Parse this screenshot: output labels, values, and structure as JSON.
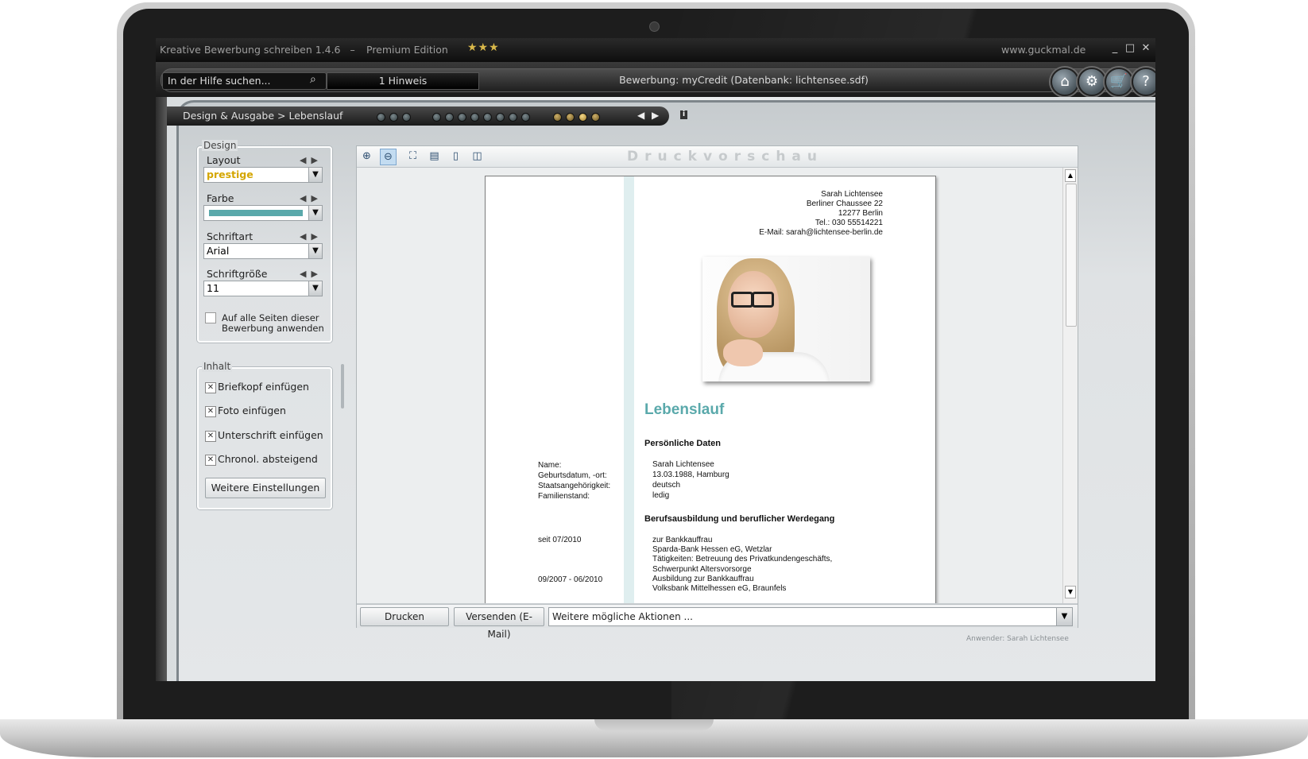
{
  "window": {
    "title": "Kreative Bewerbung schreiben 1.4.6",
    "separator": "–",
    "edition": "Premium Edition",
    "stars": "★★★",
    "website": "www.guckmal.de",
    "minimize": "_",
    "maximize": "□",
    "close": "✕"
  },
  "toolbar": {
    "search_placeholder": "In der Hilfe suchen...",
    "hint": "1 Hinweis",
    "status": "Bewerbung: myCredit (Datenbank: lichtensee.sdf)",
    "buttons": {
      "home_icon": "⌂",
      "settings_icon": "⚙",
      "cart_icon": "🛒",
      "help_icon": "?"
    }
  },
  "breadcrumb": {
    "text": "Design & Ausgabe > Lebenslauf",
    "prev": "◀",
    "next": "▶",
    "info": "i"
  },
  "design": {
    "legend": "Design",
    "layout_label": "Layout",
    "layout_value": "prestige",
    "farbe_label": "Farbe",
    "color_value": "#5aa9ab",
    "schriftart_label": "Schriftart",
    "schriftart_value": "Arial",
    "schriftgroesse_label": "Schriftgröße",
    "schriftgroesse_value": "11",
    "apply_all_line1": "Auf alle Seiten dieser",
    "apply_all_line2": "Bewerbung anwenden",
    "apply_all_checked": false,
    "arrows": "◀▶",
    "dropdown_arrow": "▼"
  },
  "inhalt": {
    "legend": "Inhalt",
    "items": [
      {
        "label": "Briefkopf einfügen",
        "checked": true,
        "mark": "✕"
      },
      {
        "label": "Foto einfügen",
        "checked": true,
        "mark": "✕"
      },
      {
        "label": "Unterschrift einfügen",
        "checked": true,
        "mark": "✕"
      },
      {
        "label": "Chronol. absteigend",
        "checked": true,
        "mark": "✕"
      }
    ],
    "more_settings": "Weitere Einstellungen"
  },
  "preview": {
    "title": "Druckvorschau",
    "document": {
      "sender_name": "Sarah Lichtensee",
      "sender_street": "Berliner Chaussee 22",
      "sender_city": "12277 Berlin",
      "sender_phone": "Tel.: 030 55514221",
      "sender_email": "E-Mail: sarah@lichtensee-berlin.de",
      "heading": "Lebenslauf",
      "personal_section": "Persönliche Daten",
      "personal_rows": [
        {
          "key": "Name:",
          "value": "Sarah Lichtensee"
        },
        {
          "key": "Geburtsdatum, -ort:",
          "value": "13.03.1988, Hamburg"
        },
        {
          "key": "Staatsangehörigkeit:",
          "value": "deutsch"
        },
        {
          "key": "Familienstand:",
          "value": "ledig"
        }
      ],
      "career_section": "Berufsausbildung und beruflicher Werdegang",
      "career_entries": [
        {
          "date": "seit 07/2010",
          "lines": [
            "zur Bankkauffrau",
            "Sparda-Bank Hessen eG, Wetzlar",
            "Tätigkeiten: Betreuung des Privatkundengeschäfts,",
            "Schwerpunkt Altersvorsorge"
          ]
        },
        {
          "date": "09/2007 - 06/2010",
          "lines": [
            "Ausbildung zur Bankkauffrau",
            "Volksbank Mittelhessen eG, Braunfels"
          ]
        }
      ]
    }
  },
  "bottom": {
    "print": "Drucken",
    "send": "Versenden (E-Mail)",
    "actions": "Weitere mögliche Aktionen ...",
    "user": "Anwender: Sarah Lichtensee"
  }
}
